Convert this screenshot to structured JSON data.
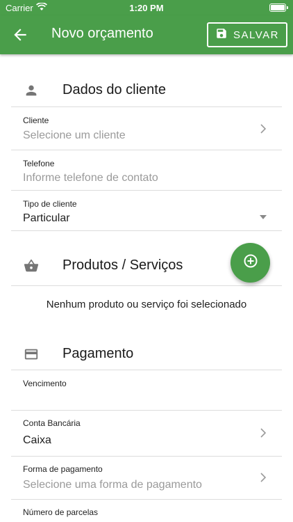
{
  "status_bar": {
    "carrier": "Carrier",
    "time": "1:20 PM"
  },
  "app_bar": {
    "title": "Novo orçamento",
    "save_label": "SALVAR"
  },
  "sections": {
    "client": {
      "title": "Dados do cliente"
    },
    "products": {
      "title": "Produtos / Serviços",
      "empty_message": "Nenhum produto ou serviço foi selecionado"
    },
    "payment": {
      "title": "Pagamento"
    }
  },
  "fields": {
    "client": {
      "label": "Cliente",
      "placeholder": "Selecione um cliente"
    },
    "phone": {
      "label": "Telefone",
      "placeholder": "Informe telefone de contato"
    },
    "client_type": {
      "label": "Tipo de cliente",
      "value": "Particular"
    },
    "due_date": {
      "label": "Vencimento",
      "value": ""
    },
    "bank_account": {
      "label": "Conta Bancária",
      "value": "Caixa"
    },
    "payment_method": {
      "label": "Forma de pagamento",
      "placeholder": "Selecione uma forma de pagamento"
    },
    "installments": {
      "label": "Número de parcelas"
    }
  },
  "colors": {
    "primary": "#4a9e4a",
    "icon_gray": "#757575",
    "placeholder": "#9a9a9a",
    "divider": "#dcdcdc"
  }
}
